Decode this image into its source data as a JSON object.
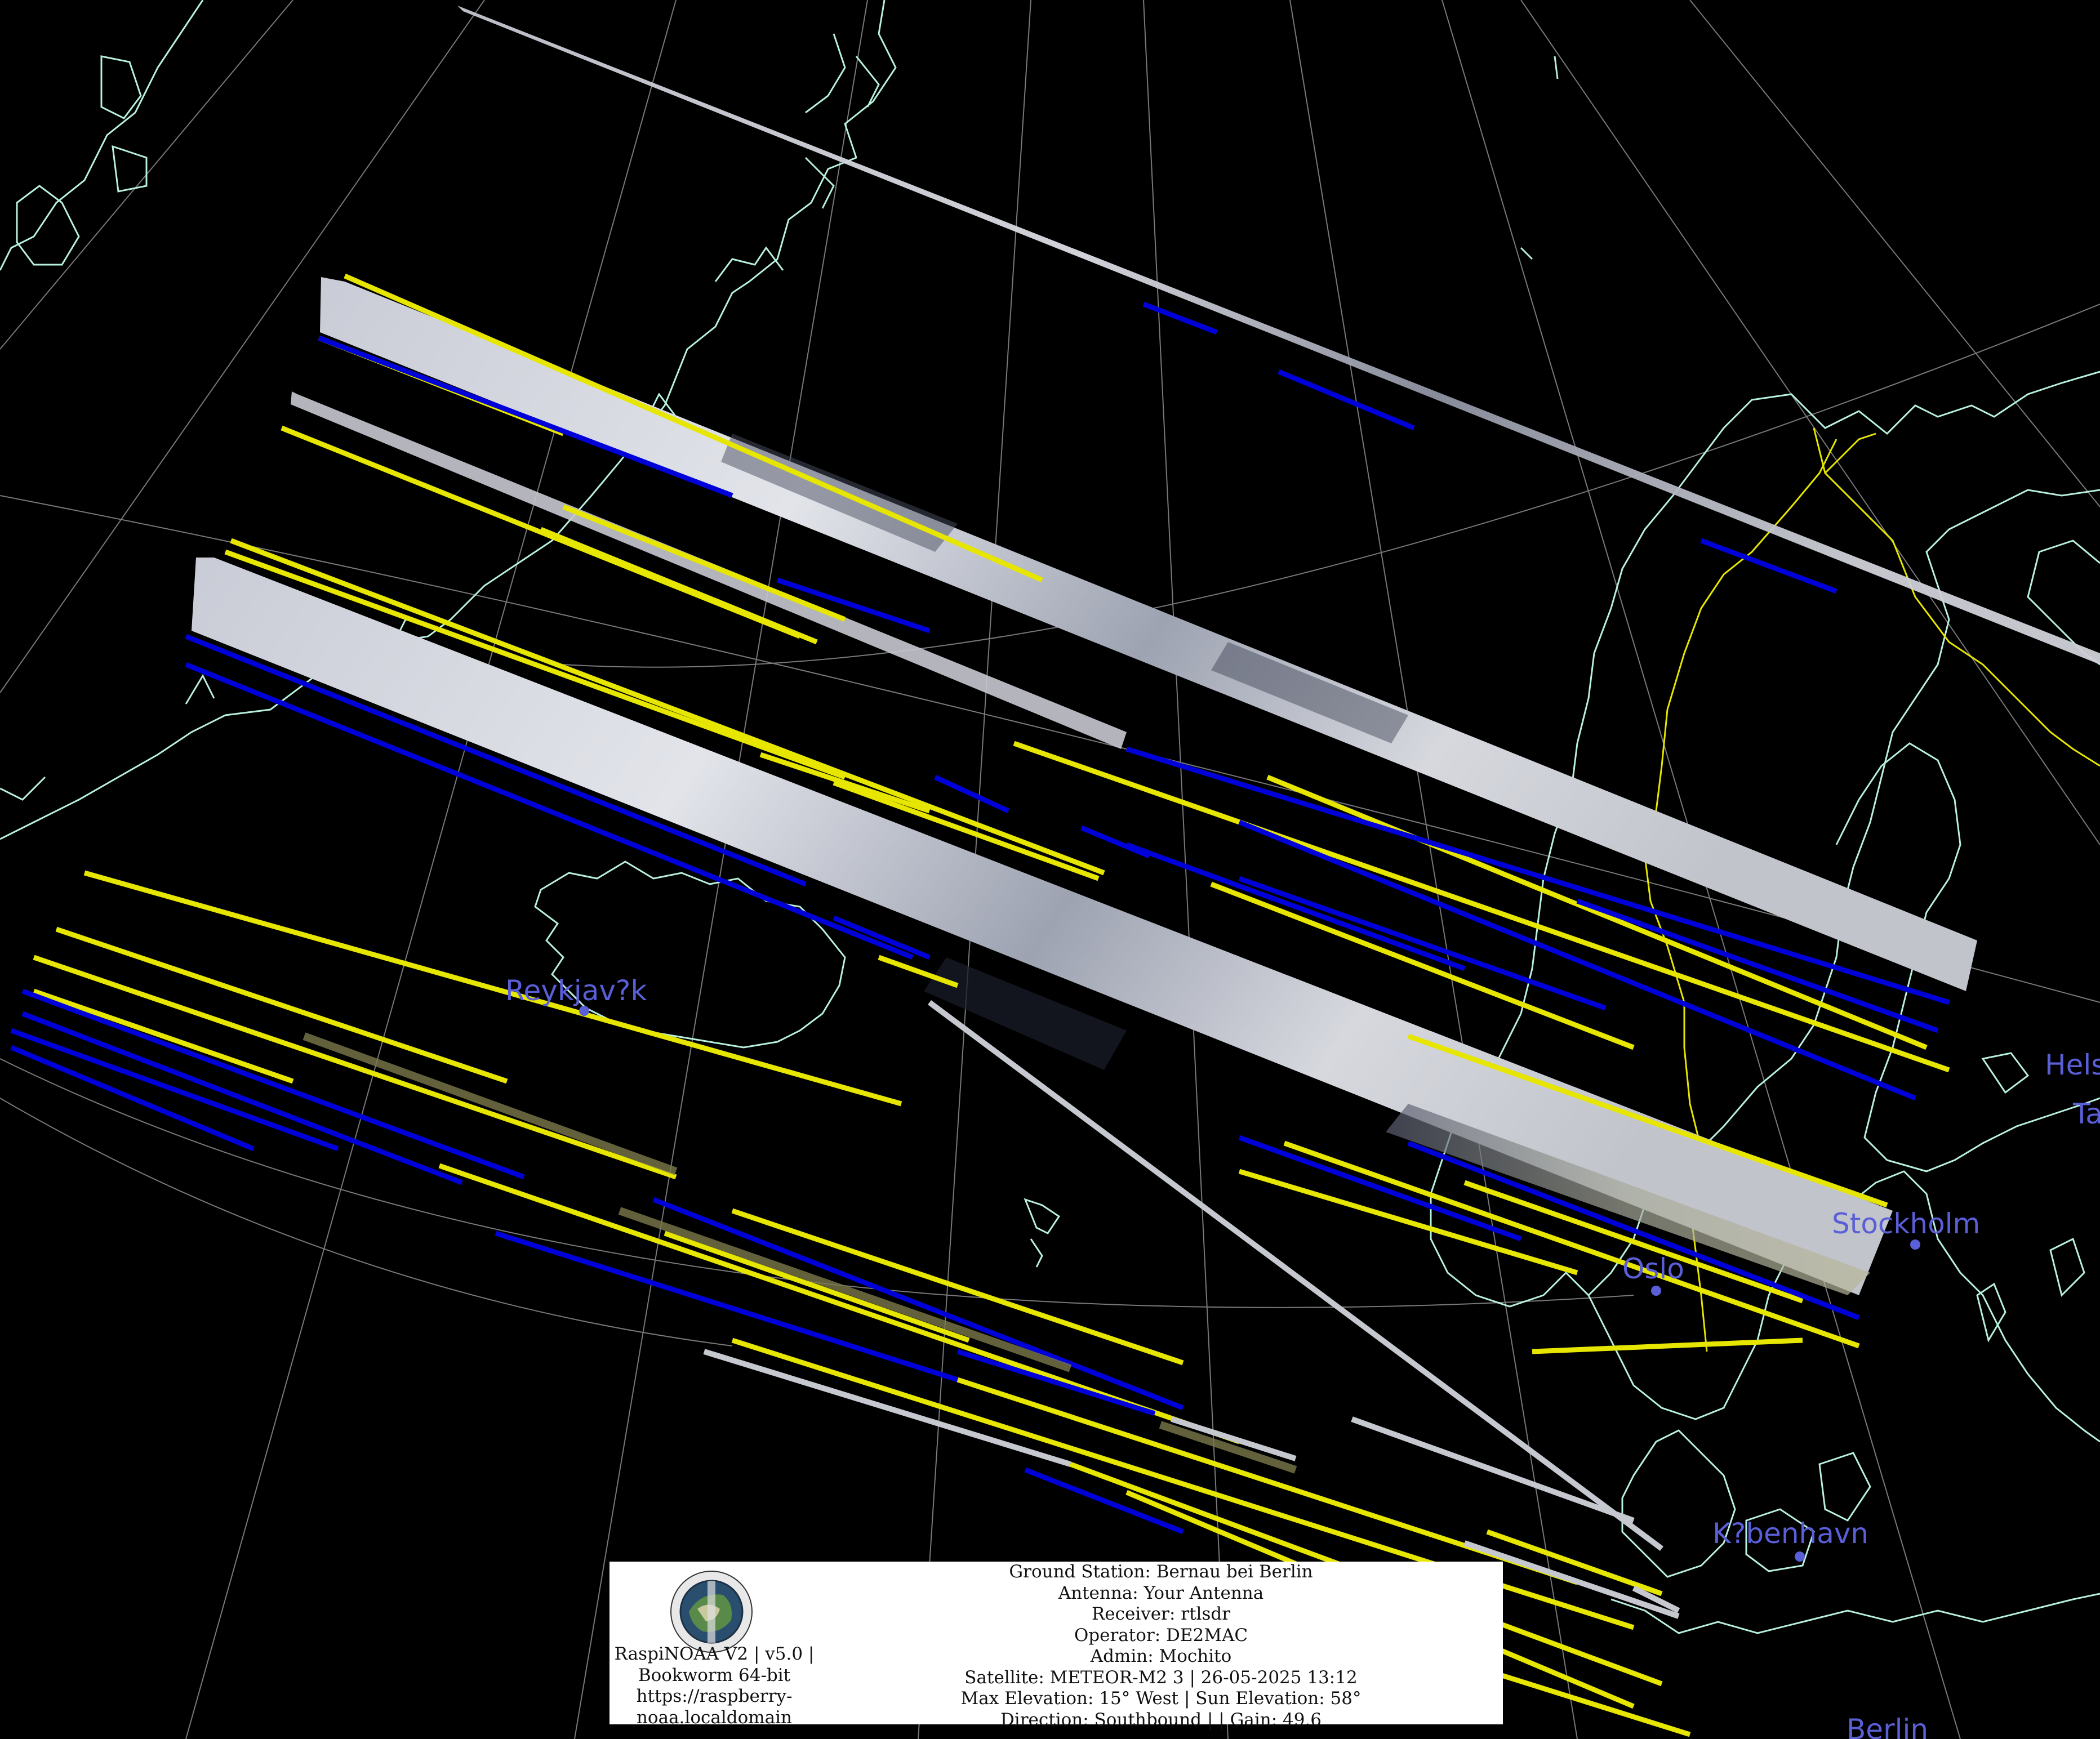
{
  "map": {
    "cities": [
      {
        "name": "Reykjav?k"
      },
      {
        "name": "Oslo"
      },
      {
        "name": "Stockholm"
      },
      {
        "name": "K?benhavn"
      },
      {
        "name": "Berlin"
      },
      {
        "name": "Hels"
      },
      {
        "name": "Ta"
      }
    ],
    "colors": {
      "background": "#000000",
      "coastline": "#b8f0e0",
      "border": "#e6e600",
      "city_label": "#5a5fd8",
      "graticule": "#9a9a9a",
      "stripe_yellow": "#e6e600",
      "stripe_blue": "#0000d8",
      "cloud": "#d9dce6"
    }
  },
  "info": {
    "logo_icon": "raspinoaa-logo-icon",
    "app_line_1": "RaspiNOAA V2 | v5.0 |",
    "app_line_2": "Bookworm 64-bit",
    "app_line_3": "https://raspberry-",
    "app_line_4": "noaa.localdomain",
    "ground_station": "Ground Station: Bernau bei Berlin",
    "antenna": "Antenna: Your Antenna",
    "receiver": "Receiver: rtlsdr",
    "operator": "Operator: DE2MAC",
    "admin": "Admin: Mochito",
    "satellite": "Satellite: METEOR-M2 3 | 26-05-2025 13:12",
    "elevation": "Max Elevation: 15° West | Sun Elevation: 58°",
    "direction": "Direction: Southbound | | Gain: 49.6"
  }
}
